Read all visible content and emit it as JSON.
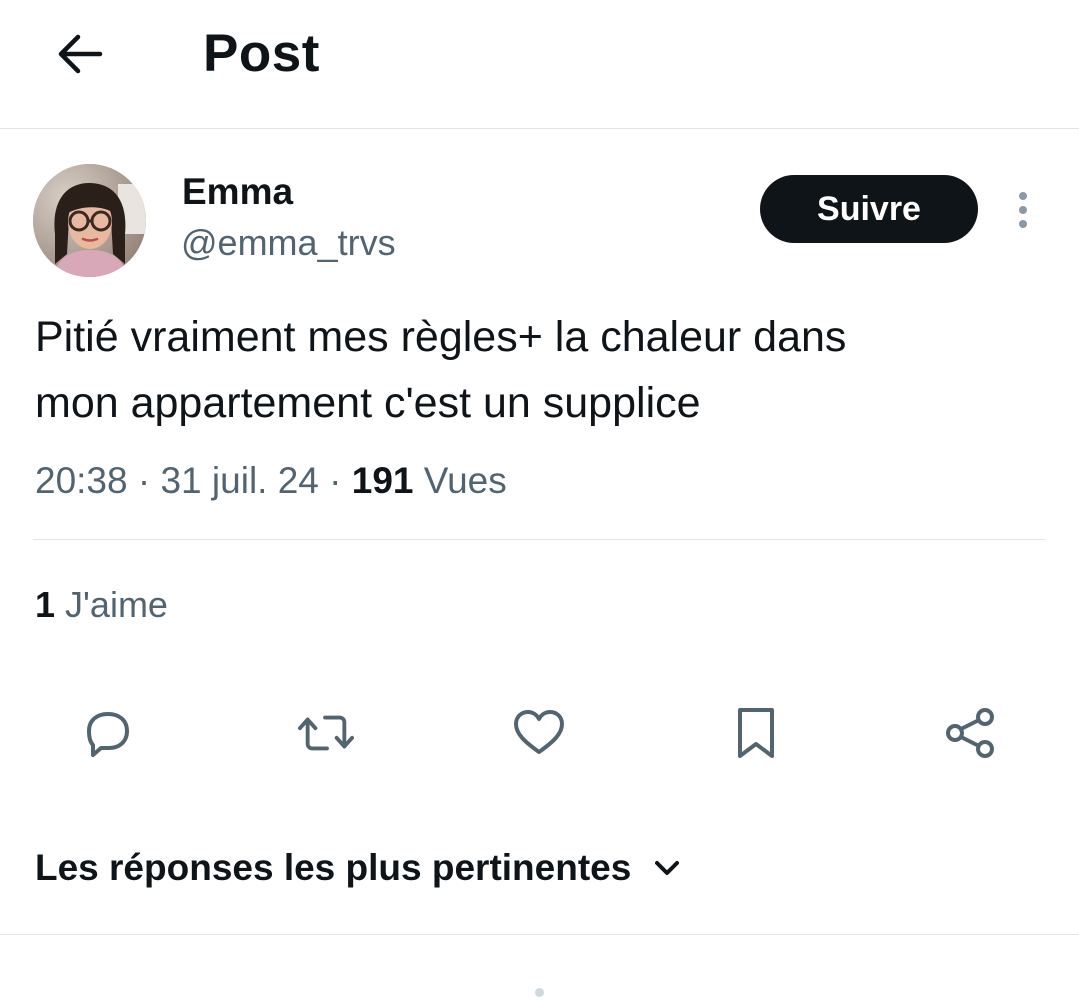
{
  "header": {
    "title": "Post"
  },
  "author": {
    "name": "Emma",
    "handle": "@emma_trvs",
    "follow_label": "Suivre"
  },
  "post": {
    "text_line1": "Pitié vraiment mes règles+ la chaleur dans",
    "text_line2": "mon appartement c'est un supplice",
    "time": "20:38",
    "separator": "·",
    "date": "31 juil. 24",
    "views_count": "191",
    "views_label": "Vues"
  },
  "engagement": {
    "likes_count": "1",
    "likes_label": "J'aime"
  },
  "actions": [
    {
      "icon": "reply-icon"
    },
    {
      "icon": "repost-icon"
    },
    {
      "icon": "like-icon"
    },
    {
      "icon": "bookmark-icon"
    },
    {
      "icon": "share-icon"
    }
  ],
  "replies": {
    "sort_label": "Les réponses les plus pertinentes"
  },
  "colors": {
    "text_primary": "#0f1419",
    "text_secondary": "#536471",
    "divider": "#e3e6e9",
    "follow_bg": "#0f1419",
    "follow_text": "#ffffff"
  }
}
